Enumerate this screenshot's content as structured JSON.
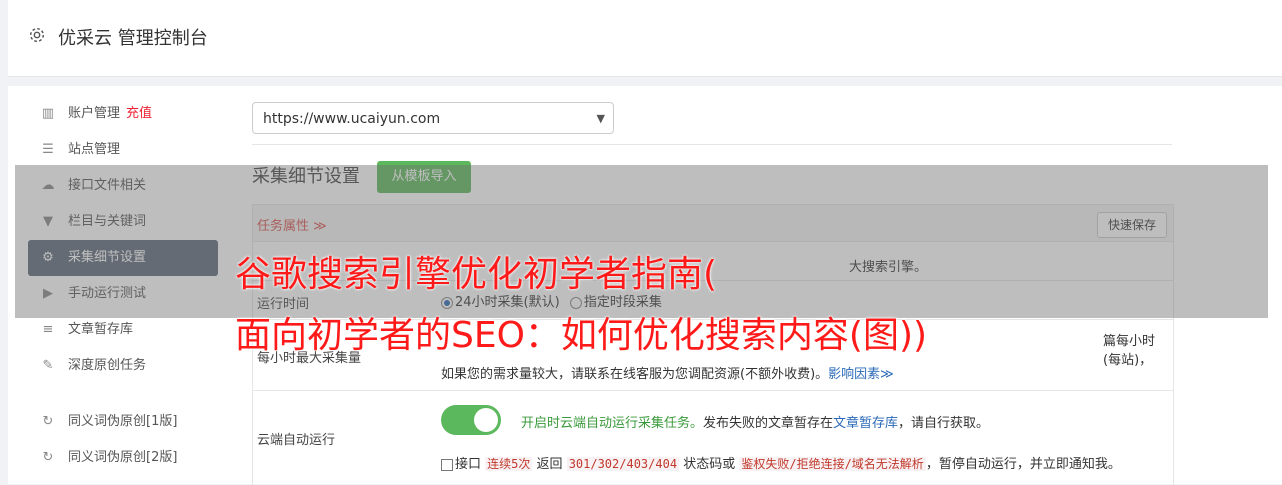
{
  "header": {
    "title": "优采云 管理控制台",
    "icon": "gear-icon"
  },
  "sidebar": {
    "items": [
      {
        "label": "账户管理",
        "extra": "充值",
        "icon": "bar-chart-icon"
      },
      {
        "label": "站点管理",
        "icon": "server-icon"
      },
      {
        "label": "接口文件相关",
        "icon": "cloud-upload-icon"
      },
      {
        "label": "栏目与关键词",
        "icon": "filter-icon"
      },
      {
        "label": "采集细节设置",
        "icon": "gears-icon",
        "active": true
      },
      {
        "label": "手动运行测试",
        "icon": "play-circle-icon"
      },
      {
        "label": "文章暂存库",
        "icon": "database-icon"
      },
      {
        "label": "深度原创任务",
        "icon": "edit-icon"
      },
      {
        "label": "同义词伪原创[1版]",
        "icon": "refresh-icon"
      },
      {
        "label": "同义词伪原创[2版]",
        "icon": "refresh-icon"
      }
    ]
  },
  "main": {
    "site_select": {
      "value": "https://www.ucaiyun.com"
    },
    "section_title": "采集细节设置",
    "template_button": "从模板导入",
    "task_attr": "任务属性 ≫",
    "quick_save": "快速保存",
    "engine_note": "大搜索引擎。",
    "run_time": {
      "label": "运行时间",
      "option1": "24小时采集(默认)",
      "option2": "指定时段采集"
    },
    "max_collect": {
      "label": "每小时最大采集量",
      "line1_suffix": "篇每小时(每站)，",
      "line2": "如果您的需求量较大，请联系在线客服为您调配资源(不额外收费)。",
      "factor_link": "影响因素≫"
    },
    "cloud_run": {
      "label": "云端自动运行",
      "desc_green": "开启时云端自动运行采集任务。",
      "desc_mid": "发布失败的文章暂存在",
      "desc_link": "文章暂存库",
      "desc_end": "，请自行获取。",
      "line2_a": "接口",
      "tag1": "连续5次",
      "line2_b": "返回",
      "tag2": "301/302/403/404",
      "line2_c": "状态码或",
      "tag3": "鉴权失败/拒绝连接/域名无法解析",
      "line2_d": "，暂停自动运行，并立即通知我。"
    }
  },
  "overlay": {
    "line1": "谷歌搜索引擎优化初学者指南(",
    "line2": "面向初学者的SEO：如何优化搜索内容(图))"
  }
}
